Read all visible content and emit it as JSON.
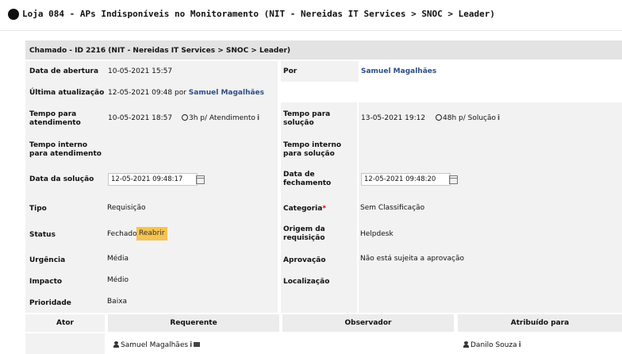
{
  "page": {
    "title": "Loja 084 - APs Indisponíveis no Monitoramento (NIT - Nereidas IT Services > SNOC > Leader)"
  },
  "ticket": {
    "header": "Chamado - ID 2216 (NIT - Nereidas IT Services > SNOC > Leader)",
    "opening_date_label": "Data de abertura",
    "opening_date": "10-05-2021 15:57",
    "by_label": "Por",
    "by_user": "Samuel Magalhães",
    "last_update_label": "Última atualização",
    "last_update_date": "12-05-2021 09:48",
    "last_update_por": "por",
    "last_update_user": "Samuel Magalhães",
    "tta_label": "Tempo para atendimento",
    "tta_value": "10-05-2021 18:57",
    "tta_sla": "3h p/ Atendimento",
    "tts_label": "Tempo para solução",
    "tts_value": "13-05-2021 19:12",
    "tts_sla": "48h p/ Solução",
    "internal_tta_label": "Tempo interno para atendimento",
    "internal_tts_label": "Tempo interno para solução",
    "solve_date_label": "Data da solução",
    "solve_date": "12-05-2021 09:48:17",
    "close_date_label": "Data de fechamento",
    "close_date": "12-05-2021 09:48:20",
    "type_label": "Tipo",
    "type_value": "Requisição",
    "category_label": "Categoria",
    "category_required": "*",
    "category_value": "Sem Classificação",
    "status_label": "Status",
    "status_value": "Fechado",
    "reopen_label": "Reabrir",
    "origin_label": "Origem da requisição",
    "origin_value": "Helpdesk",
    "urgency_label": "Urgência",
    "urgency_value": "Média",
    "approval_label": "Aprovação",
    "approval_value": "Não está sujeita a aprovação",
    "impact_label": "Impacto",
    "impact_value": "Médio",
    "location_label": "Localização",
    "priority_label": "Prioridade",
    "priority_value": "Baixa"
  },
  "actors": {
    "actor_label": "Ator",
    "requester_label": "Requerente",
    "observer_label": "Observador",
    "assigned_label": "Atribuído para",
    "requester_user": "Samuel Magalhães",
    "assigned_user": "Danilo Souza",
    "info_glyph": "i"
  },
  "colors": {
    "reopen_bg": "#f6c350",
    "link": "#2e4e84",
    "header_bg": "#e3e3e3",
    "block_bg": "#f2f2f2"
  }
}
